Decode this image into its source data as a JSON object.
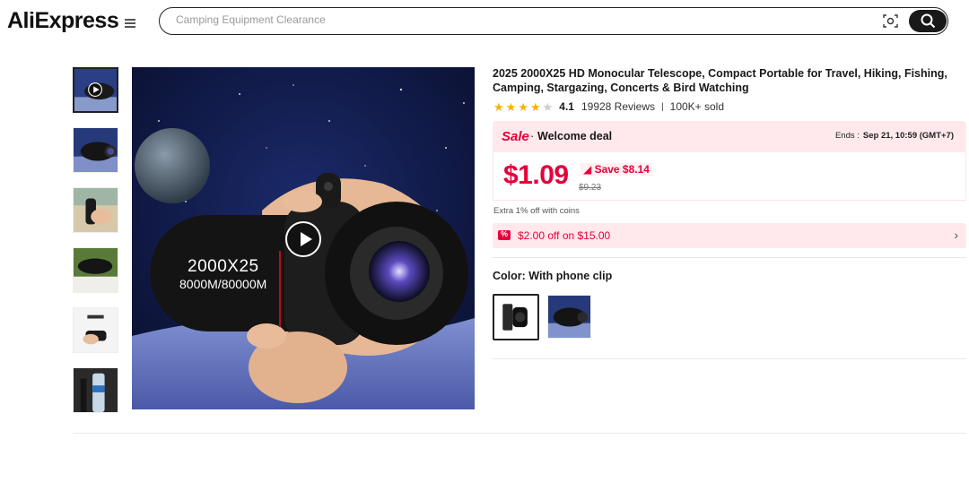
{
  "header": {
    "logo_text": "AliExpress",
    "search_placeholder": "Camping Equipment Clearance",
    "icons": [
      "menu-icon",
      "camera-search-icon",
      "search-icon"
    ]
  },
  "gallery": {
    "thumbnail_count": 6,
    "active_index": 0,
    "main_overlay_line1": "2000X25",
    "main_overlay_line2": "8000M/80000M"
  },
  "product": {
    "title": "2025 2000X25 HD Monocular Telescope, Compact Portable for Travel, Hiking, Fishing, Camping, Stargazing, Concerts & Bird Watching",
    "rating": "4.1",
    "rating_stars": 4,
    "reviews": "19928 Reviews",
    "separator": "|",
    "sold": "100K+ sold"
  },
  "sale": {
    "label": "Sale",
    "dot": "·",
    "deal_name": "Welcome deal",
    "ends_label": "Ends :",
    "ends_time": "Sep 21, 10:59 (GMT+7)",
    "price": "$1.09",
    "save_text": "Save $8.14",
    "original_price": "$9.23",
    "coins_text": "Extra 1% off with coins",
    "coupon_text": "$2.00 off on $15.00",
    "coupon_arrow": "›"
  },
  "variants": {
    "color_label": "Color: With phone clip",
    "options_count": 2,
    "selected_index": 0
  },
  "colors": {
    "brand_red": "#e5003a",
    "sale_bg": "#ffe9ec",
    "star": "#f5b400",
    "text": "#191919"
  }
}
